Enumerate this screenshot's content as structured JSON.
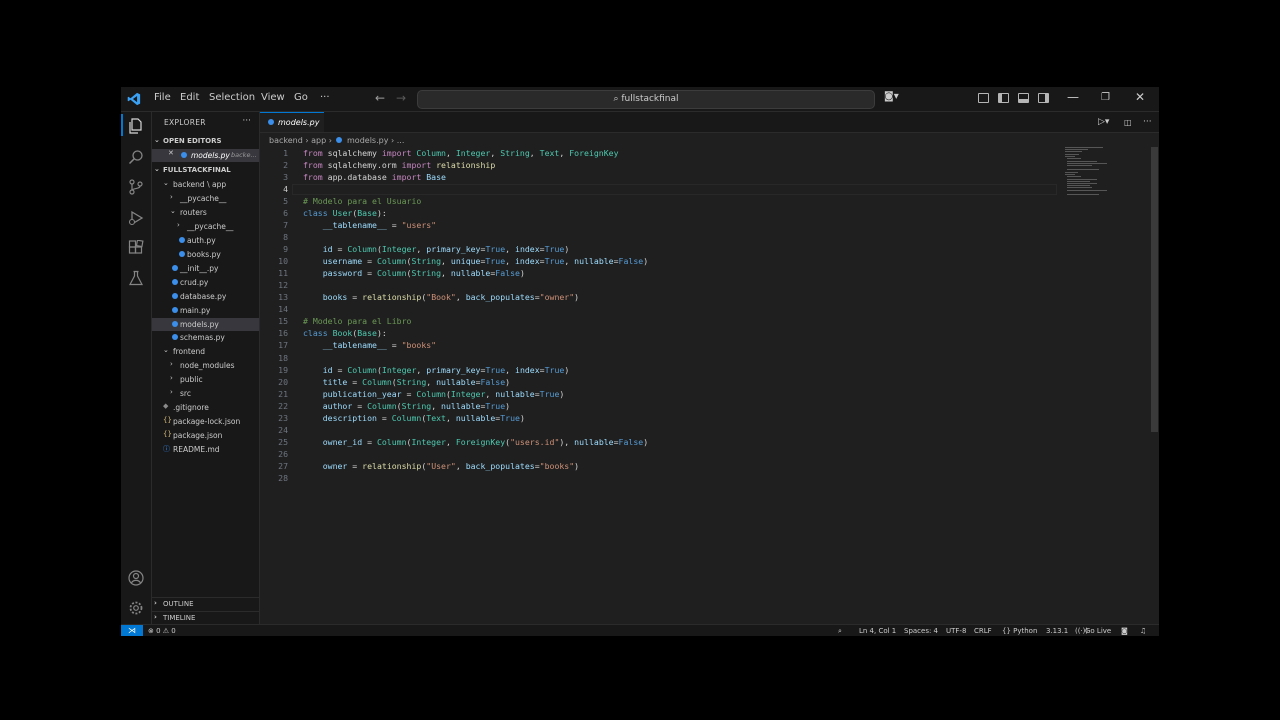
{
  "titlebar": {
    "menus": [
      "File",
      "Edit",
      "Selection",
      "View",
      "Go",
      "···"
    ],
    "search_text": "fullstackfinal",
    "colors": {
      "accent": "#0078d4",
      "background": "#1f1f1f"
    }
  },
  "sidebar": {
    "title": "EXPLORER",
    "more": "···",
    "open_editors_label": "OPEN EDITORS",
    "open_editor_file": "models.py",
    "open_editor_path": "backe...",
    "project_label": "FULLSTACKFINAL",
    "tree": [
      {
        "label": "backend \\ app",
        "type": "folder-open"
      },
      {
        "label": "__pycache__",
        "type": "folder"
      },
      {
        "label": "routers",
        "type": "folder-open"
      },
      {
        "label": "__pycache__",
        "type": "folder"
      },
      {
        "label": "auth.py",
        "type": "python"
      },
      {
        "label": "books.py",
        "type": "python"
      },
      {
        "label": "__init__.py",
        "type": "python"
      },
      {
        "label": "crud.py",
        "type": "python"
      },
      {
        "label": "database.py",
        "type": "python"
      },
      {
        "label": "main.py",
        "type": "python"
      },
      {
        "label": "models.py",
        "type": "python"
      },
      {
        "label": "schemas.py",
        "type": "python"
      },
      {
        "label": "frontend",
        "type": "folder-open"
      },
      {
        "label": "node_modules",
        "type": "folder"
      },
      {
        "label": "public",
        "type": "folder"
      },
      {
        "label": "src",
        "type": "folder"
      },
      {
        "label": ".gitignore",
        "type": "git"
      },
      {
        "label": "package-lock.json",
        "type": "json"
      },
      {
        "label": "package.json",
        "type": "json"
      },
      {
        "label": "README.md",
        "type": "info"
      }
    ],
    "outline_label": "OUTLINE",
    "timeline_label": "TIMELINE"
  },
  "editor": {
    "tab_label": "models.py",
    "breadcrumb": [
      "backend",
      "app",
      "models.py",
      "..."
    ],
    "current_line": 4,
    "lines": [
      [
        [
          "kw",
          "from"
        ],
        [
          "plain",
          " sqlalchemy "
        ],
        [
          "kw",
          "import"
        ],
        [
          "plain",
          " "
        ],
        [
          "cls",
          "Column"
        ],
        [
          "plain",
          ", "
        ],
        [
          "cls",
          "Integer"
        ],
        [
          "plain",
          ", "
        ],
        [
          "cls",
          "String"
        ],
        [
          "plain",
          ", "
        ],
        [
          "cls",
          "Text"
        ],
        [
          "plain",
          ", "
        ],
        [
          "cls",
          "ForeignKey"
        ]
      ],
      [
        [
          "kw",
          "from"
        ],
        [
          "plain",
          " sqlalchemy.orm "
        ],
        [
          "kw",
          "import"
        ],
        [
          "plain",
          " "
        ],
        [
          "fn",
          "relationship"
        ]
      ],
      [
        [
          "kw",
          "from"
        ],
        [
          "plain",
          " app.database "
        ],
        [
          "kw",
          "import"
        ],
        [
          "plain",
          " "
        ],
        [
          "var",
          "Base"
        ]
      ],
      [],
      [
        [
          "cm",
          "# Modelo para el Usuario"
        ]
      ],
      [
        [
          "cst",
          "class"
        ],
        [
          "plain",
          " "
        ],
        [
          "cls",
          "User"
        ],
        [
          "plain",
          "("
        ],
        [
          "cls",
          "Base"
        ],
        [
          "plain",
          "):"
        ]
      ],
      [
        [
          "plain",
          "    "
        ],
        [
          "var",
          "__tablename__"
        ],
        [
          "plain",
          " = "
        ],
        [
          "str",
          "\"users\""
        ]
      ],
      [],
      [
        [
          "plain",
          "    "
        ],
        [
          "var",
          "id"
        ],
        [
          "plain",
          " = "
        ],
        [
          "cls",
          "Column"
        ],
        [
          "plain",
          "("
        ],
        [
          "cls",
          "Integer"
        ],
        [
          "plain",
          ", "
        ],
        [
          "var",
          "primary_key"
        ],
        [
          "plain",
          "="
        ],
        [
          "cst",
          "True"
        ],
        [
          "plain",
          ", "
        ],
        [
          "var",
          "index"
        ],
        [
          "plain",
          "="
        ],
        [
          "cst",
          "True"
        ],
        [
          "plain",
          ")"
        ]
      ],
      [
        [
          "plain",
          "    "
        ],
        [
          "var",
          "username"
        ],
        [
          "plain",
          " = "
        ],
        [
          "cls",
          "Column"
        ],
        [
          "plain",
          "("
        ],
        [
          "cls",
          "String"
        ],
        [
          "plain",
          ", "
        ],
        [
          "var",
          "unique"
        ],
        [
          "plain",
          "="
        ],
        [
          "cst",
          "True"
        ],
        [
          "plain",
          ", "
        ],
        [
          "var",
          "index"
        ],
        [
          "plain",
          "="
        ],
        [
          "cst",
          "True"
        ],
        [
          "plain",
          ", "
        ],
        [
          "var",
          "nullable"
        ],
        [
          "plain",
          "="
        ],
        [
          "cst",
          "False"
        ],
        [
          "plain",
          ")"
        ]
      ],
      [
        [
          "plain",
          "    "
        ],
        [
          "var",
          "password"
        ],
        [
          "plain",
          " = "
        ],
        [
          "cls",
          "Column"
        ],
        [
          "plain",
          "("
        ],
        [
          "cls",
          "String"
        ],
        [
          "plain",
          ", "
        ],
        [
          "var",
          "nullable"
        ],
        [
          "plain",
          "="
        ],
        [
          "cst",
          "False"
        ],
        [
          "plain",
          ")"
        ]
      ],
      [],
      [
        [
          "plain",
          "    "
        ],
        [
          "var",
          "books"
        ],
        [
          "plain",
          " = "
        ],
        [
          "fn",
          "relationship"
        ],
        [
          "plain",
          "("
        ],
        [
          "str",
          "\"Book\""
        ],
        [
          "plain",
          ", "
        ],
        [
          "var",
          "back_populates"
        ],
        [
          "plain",
          "="
        ],
        [
          "str",
          "\"owner\""
        ],
        [
          "plain",
          ")"
        ]
      ],
      [],
      [
        [
          "cm",
          "# Modelo para el Libro"
        ]
      ],
      [
        [
          "cst",
          "class"
        ],
        [
          "plain",
          " "
        ],
        [
          "cls",
          "Book"
        ],
        [
          "plain",
          "("
        ],
        [
          "cls",
          "Base"
        ],
        [
          "plain",
          "):"
        ]
      ],
      [
        [
          "plain",
          "    "
        ],
        [
          "var",
          "__tablename__"
        ],
        [
          "plain",
          " = "
        ],
        [
          "str",
          "\"books\""
        ]
      ],
      [],
      [
        [
          "plain",
          "    "
        ],
        [
          "var",
          "id"
        ],
        [
          "plain",
          " = "
        ],
        [
          "cls",
          "Column"
        ],
        [
          "plain",
          "("
        ],
        [
          "cls",
          "Integer"
        ],
        [
          "plain",
          ", "
        ],
        [
          "var",
          "primary_key"
        ],
        [
          "plain",
          "="
        ],
        [
          "cst",
          "True"
        ],
        [
          "plain",
          ", "
        ],
        [
          "var",
          "index"
        ],
        [
          "plain",
          "="
        ],
        [
          "cst",
          "True"
        ],
        [
          "plain",
          ")"
        ]
      ],
      [
        [
          "plain",
          "    "
        ],
        [
          "var",
          "title"
        ],
        [
          "plain",
          " = "
        ],
        [
          "cls",
          "Column"
        ],
        [
          "plain",
          "("
        ],
        [
          "cls",
          "String"
        ],
        [
          "plain",
          ", "
        ],
        [
          "var",
          "nullable"
        ],
        [
          "plain",
          "="
        ],
        [
          "cst",
          "False"
        ],
        [
          "plain",
          ")"
        ]
      ],
      [
        [
          "plain",
          "    "
        ],
        [
          "var",
          "publication_year"
        ],
        [
          "plain",
          " = "
        ],
        [
          "cls",
          "Column"
        ],
        [
          "plain",
          "("
        ],
        [
          "cls",
          "Integer"
        ],
        [
          "plain",
          ", "
        ],
        [
          "var",
          "nullable"
        ],
        [
          "plain",
          "="
        ],
        [
          "cst",
          "True"
        ],
        [
          "plain",
          ")"
        ]
      ],
      [
        [
          "plain",
          "    "
        ],
        [
          "var",
          "author"
        ],
        [
          "plain",
          " = "
        ],
        [
          "cls",
          "Column"
        ],
        [
          "plain",
          "("
        ],
        [
          "cls",
          "String"
        ],
        [
          "plain",
          ", "
        ],
        [
          "var",
          "nullable"
        ],
        [
          "plain",
          "="
        ],
        [
          "cst",
          "True"
        ],
        [
          "plain",
          ")"
        ]
      ],
      [
        [
          "plain",
          "    "
        ],
        [
          "var",
          "description"
        ],
        [
          "plain",
          " = "
        ],
        [
          "cls",
          "Column"
        ],
        [
          "plain",
          "("
        ],
        [
          "cls",
          "Text"
        ],
        [
          "plain",
          ", "
        ],
        [
          "var",
          "nullable"
        ],
        [
          "plain",
          "="
        ],
        [
          "cst",
          "True"
        ],
        [
          "plain",
          ")"
        ]
      ],
      [],
      [
        [
          "plain",
          "    "
        ],
        [
          "var",
          "owner_id"
        ],
        [
          "plain",
          " = "
        ],
        [
          "cls",
          "Column"
        ],
        [
          "plain",
          "("
        ],
        [
          "cls",
          "Integer"
        ],
        [
          "plain",
          ", "
        ],
        [
          "cls",
          "ForeignKey"
        ],
        [
          "plain",
          "("
        ],
        [
          "str",
          "\"users.id\""
        ],
        [
          "plain",
          "), "
        ],
        [
          "var",
          "nullable"
        ],
        [
          "plain",
          "="
        ],
        [
          "cst",
          "False"
        ],
        [
          "plain",
          ")"
        ]
      ],
      [],
      [
        [
          "plain",
          "    "
        ],
        [
          "var",
          "owner"
        ],
        [
          "plain",
          " = "
        ],
        [
          "fn",
          "relationship"
        ],
        [
          "plain",
          "("
        ],
        [
          "str",
          "\"User\""
        ],
        [
          "plain",
          ", "
        ],
        [
          "var",
          "back_populates"
        ],
        [
          "plain",
          "="
        ],
        [
          "str",
          "\"books\""
        ],
        [
          "plain",
          ")"
        ]
      ],
      []
    ]
  },
  "statusbar": {
    "problems": "⊗ 0 ⚠ 0",
    "position": "Ln 4, Col 1",
    "spaces": "Spaces: 4",
    "encoding": "UTF-8",
    "eol": "CRLF",
    "language": "{} Python",
    "version": "3.13.1",
    "golive": "Go Live"
  }
}
